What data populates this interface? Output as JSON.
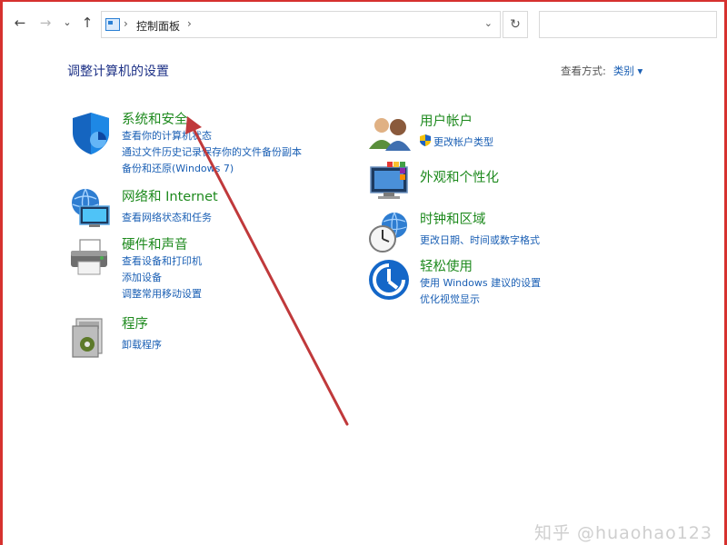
{
  "nav": {
    "back": "←",
    "forward": "→",
    "recent": "⌄",
    "up": "↑",
    "refresh": "↻"
  },
  "address": {
    "sep1": "›",
    "location": "控制面板",
    "sep2": "›",
    "dropdown": "⌄"
  },
  "search": {
    "placeholder": ""
  },
  "page": {
    "title": "调整计算机的设置",
    "view_by_label": "查看方式:",
    "view_by_value": "类别 ▾"
  },
  "categories_left": [
    {
      "title": "系统和安全",
      "links": [
        "查看你的计算机状态",
        "通过文件历史记录保存你的文件备份副本",
        "备份和还原(Windows 7)"
      ]
    },
    {
      "title": "网络和 Internet",
      "links": [
        "查看网络状态和任务"
      ]
    },
    {
      "title": "硬件和声音",
      "links": [
        "查看设备和打印机",
        "添加设备",
        "调整常用移动设置"
      ]
    },
    {
      "title": "程序",
      "links": [
        "卸载程序"
      ]
    }
  ],
  "categories_right": [
    {
      "title": "用户帐户",
      "links": [
        "更改帐户类型"
      ]
    },
    {
      "title": "外观和个性化",
      "links": []
    },
    {
      "title": "时钟和区域",
      "links": [
        "更改日期、时间或数字格式"
      ]
    },
    {
      "title": "轻松使用",
      "links": [
        "使用 Windows 建议的设置",
        "优化视觉显示"
      ]
    }
  ],
  "watermark": "知乎 @huaohao123",
  "colors": {
    "frame": "#d6312f",
    "link": "#1a5fb4",
    "category_title": "#1e8a1e",
    "annotation_arrow": "#c0393b"
  }
}
